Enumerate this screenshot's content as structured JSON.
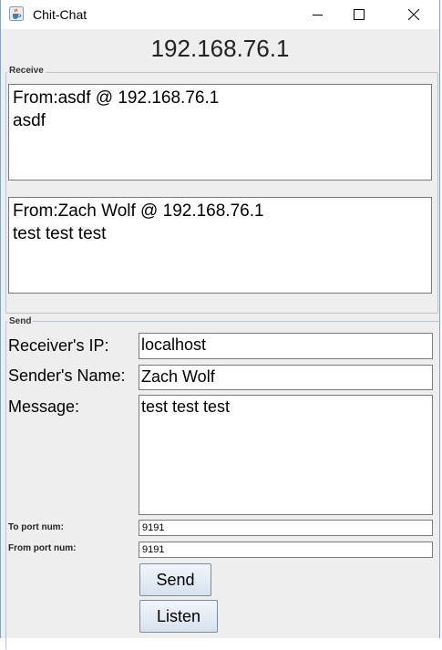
{
  "window": {
    "title": "Chit-Chat",
    "icon": "java-coffee-cup-icon",
    "controls": [
      "minimize-icon",
      "maximize-icon",
      "close-icon"
    ]
  },
  "header": {
    "ip": "192.168.76.1"
  },
  "receive": {
    "label": "Receive",
    "messages": [
      {
        "from": "From:asdf @ 192.168.76.1",
        "body": "asdf"
      },
      {
        "from": "From:Zach Wolf @ 192.168.76.1",
        "body": "test test test"
      }
    ]
  },
  "send": {
    "label": "Send",
    "receiver_ip_label": "Receiver's IP:",
    "receiver_ip_value": "localhost",
    "sender_name_label": "Sender's Name:",
    "sender_name_value": "Zach Wolf",
    "message_label": "Message:",
    "message_value": "test test test",
    "to_port_label": "To port num:",
    "to_port_value": "9191",
    "from_port_label": "From port num:",
    "from_port_value": "9191",
    "send_button": "Send",
    "listen_button": "Listen"
  }
}
